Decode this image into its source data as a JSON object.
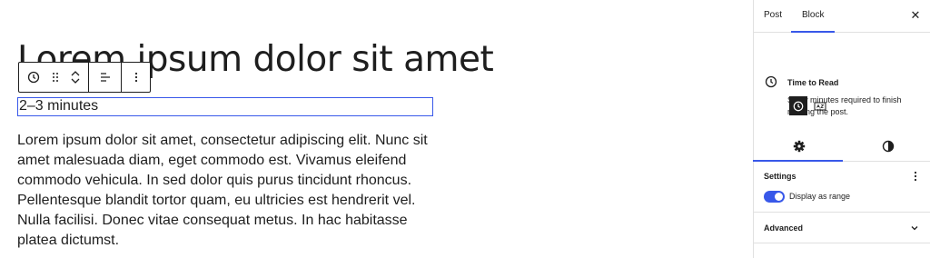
{
  "editor": {
    "post_title": "Lorem ipsum dolor sit amet",
    "ttr_block_text": "2–3 minutes",
    "paragraph": "Lorem ipsum dolor sit amet, consectetur adipiscing elit. Nunc sit amet malesuada diam, eget commodo est. Vivamus eleifend commodo vehicula. In sed dolor quis purus tincidunt rhoncus. Pellentesque blandit tortor quam, eu ultricies est hendrerit vel. Nulla facilisi. Donec vitae consequat metus. In hac habitasse platea dictumst."
  },
  "toolbar": {
    "icons": [
      "clock-icon",
      "drag-handle-icon",
      "chevron-up-icon",
      "chevron-down-icon",
      "align-left-icon",
      "more-vertical-icon"
    ]
  },
  "sidebar": {
    "tabs": [
      "Post",
      "Block"
    ],
    "active_tab": "Block",
    "close_glyph": "✕",
    "block_card": {
      "title": "Time to Read",
      "description": "Show minutes required to finish reading the post."
    },
    "inner_tabs": [
      "settings-gear-icon",
      "styles-contrast-icon"
    ],
    "settings_panel": {
      "title": "Settings",
      "toggle_label": "Display as range",
      "toggle_on": true
    },
    "advanced_panel": {
      "title": "Advanced"
    }
  },
  "colors": {
    "accent": "#3858e9",
    "text": "#1e1e1e",
    "border": "#e0e0e0"
  }
}
